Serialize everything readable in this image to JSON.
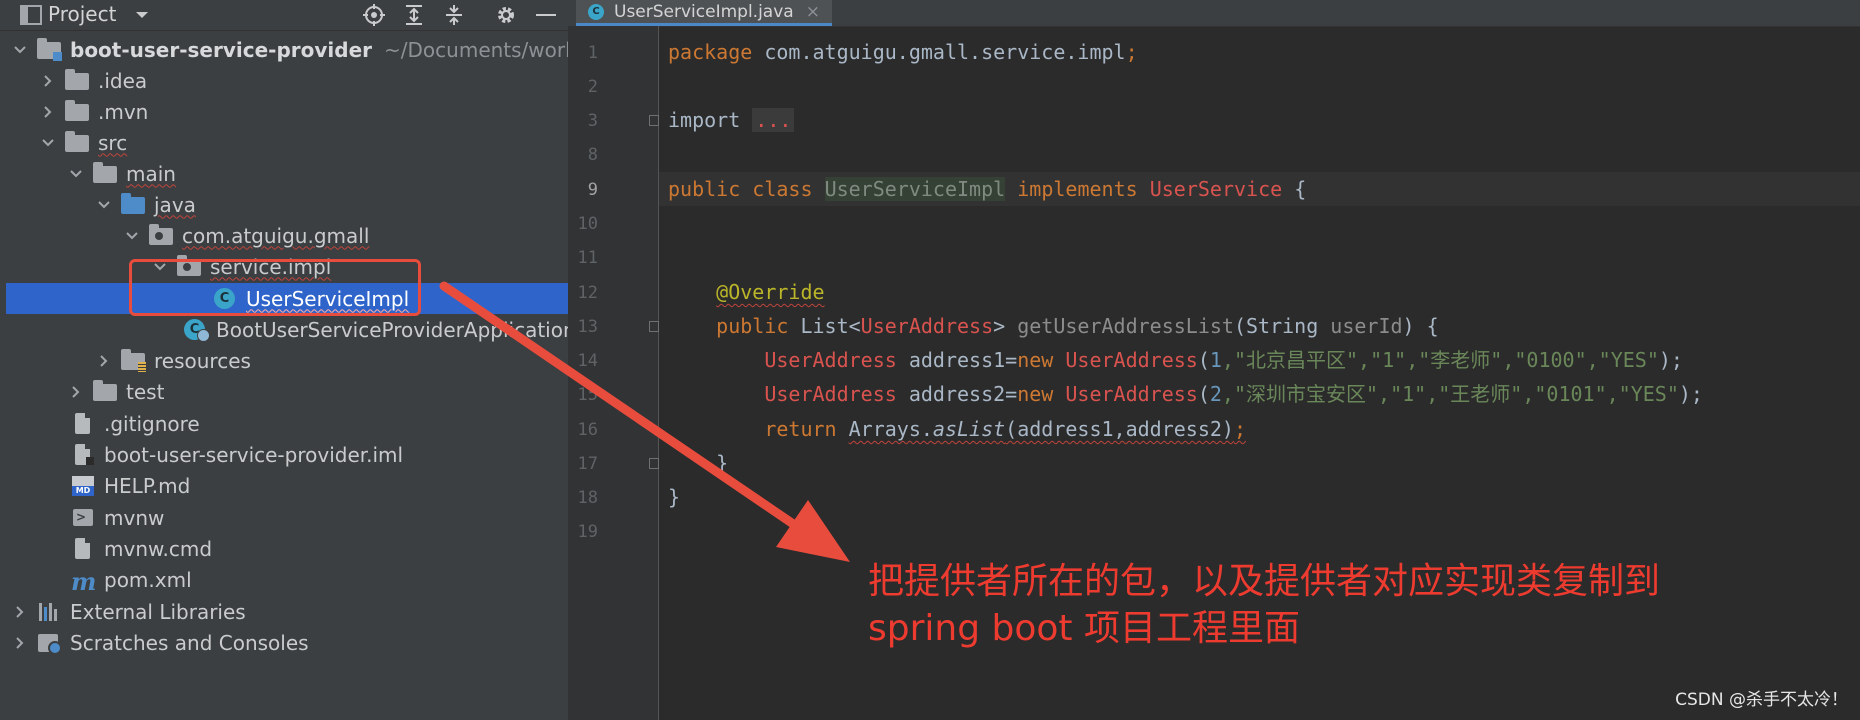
{
  "panel": {
    "title": "Project",
    "icons": [
      "project-window-icon",
      "dropdown-chevron-icon",
      "locate-icon",
      "expand-all-icon",
      "collapse-all-icon",
      "gear-icon",
      "minimize-icon"
    ]
  },
  "tree": {
    "root_label": "boot-user-service-provider",
    "root_path": "~/Documents/worke",
    "idea": ".idea",
    "mvn": ".mvn",
    "src": "src",
    "main": "main",
    "java": "java",
    "pkg": "com.atguigu.gmall",
    "service_impl": "service.impl",
    "user_service_impl": "UserServiceImpl",
    "boot_app": "BootUserServiceProviderApplication",
    "resources": "resources",
    "test": "test",
    "gitignore": ".gitignore",
    "iml": "boot-user-service-provider.iml",
    "help": "HELP.md",
    "mvnw": "mvnw",
    "mvnw_cmd": "mvnw.cmd",
    "pom": "pom.xml",
    "external_libraries": "External Libraries",
    "scratches": "Scratches and Consoles"
  },
  "editor": {
    "tab_label": "UserServiceImpl.java",
    "tab_close": "×",
    "line_numbers": [
      "1",
      "2",
      "3",
      "8",
      "9",
      "10",
      "11",
      "12",
      "13",
      "14",
      "15",
      "16",
      "17",
      "18",
      "19"
    ],
    "active_line": "9"
  },
  "code": {
    "l1_kw": "package",
    "l1_rest": " com.atguigu.gmall.service.impl",
    "l1_semi": ";",
    "l3_kw": "import",
    "l3_ellipsis": "...",
    "l9_public": "public",
    "l9_class": "class",
    "l9_name": "UserServiceImpl",
    "l9_implements": "implements",
    "l9_iface": "UserService",
    "l9_brace": " {",
    "l12_ann": "@Override",
    "l13_public": "public",
    "l13_list": " List<",
    "l13_type": "UserAddress",
    "l13_gt": "> ",
    "l13_method": "getUserAddressList",
    "l13_params": "(String ",
    "l13_param": "userId",
    "l13_end": ") {",
    "l14_type": "UserAddress",
    "l14_var": " address1=",
    "l14_new": "new",
    "l14_ctor": "UserAddress",
    "l14_open": "(",
    "l14_n": "1",
    "l14_strs": ",\"北京昌平区\",\"1\",\"李老师\",\"0100\",\"YES\"",
    "l14_end": ");",
    "l15_type": "UserAddress",
    "l15_var": " address2=",
    "l15_new": "new",
    "l15_ctor": "UserAddress",
    "l15_open": "(",
    "l15_n": "2",
    "l15_strs": ",\"深圳市宝安区\",\"1\",\"王老师\",\"0101\",\"YES\"",
    "l15_end": ");",
    "l16_return": "return",
    "l16_arrays": "Arrays.",
    "l16_aslist": "asList",
    "l16_args": "(address1,address2)",
    "l16_semi": ";",
    "l17_brace": "}",
    "l18_brace": "}"
  },
  "annotation": {
    "line1": "把提供者所在的包，以及提供者对应实现类复制到",
    "line2": "spring boot 项目工程里面",
    "color": "#ee3b30"
  },
  "watermark": "CSDN @杀手不太冷！"
}
